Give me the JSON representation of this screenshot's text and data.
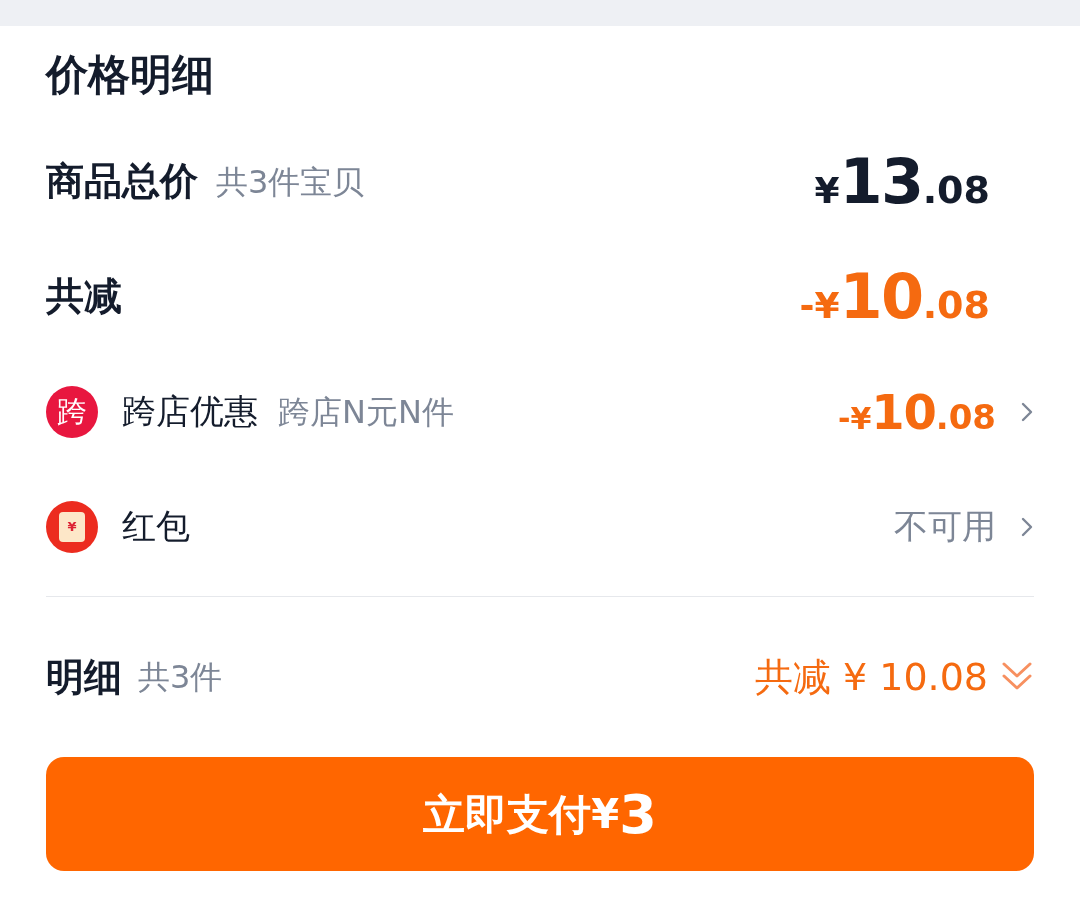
{
  "title": "价格明细",
  "rows": [
    {
      "kind": "summary",
      "label": "商品总价",
      "note": "共3件宝贝",
      "amount": {
        "sign": "¥",
        "integer": "13",
        "decimal": ".08",
        "color": "#141c2c"
      }
    },
    {
      "kind": "summary",
      "label": "共减",
      "amount": {
        "sign": "-¥",
        "integer": "10",
        "decimal": ".08",
        "color": "#f56a10"
      }
    },
    {
      "kind": "discount",
      "icon": {
        "kind": "badge",
        "text": "跨"
      },
      "label": "跨店优惠",
      "note": "跨店N元N件",
      "amount": {
        "sign": "-¥",
        "integer": "10",
        "decimal": ".08",
        "color": "#f56a10"
      },
      "chevron": true
    },
    {
      "kind": "discount",
      "icon": {
        "kind": "envelope",
        "text": "¥"
      },
      "label": "红包",
      "status": "不可用",
      "chevron": true
    }
  ],
  "detail": {
    "label": "明细",
    "note": "共3件",
    "total": "共减 ¥ 10.08",
    "expanded": false
  },
  "pay_button": {
    "label": "立即支付",
    "sign": "¥",
    "amount": "3"
  }
}
